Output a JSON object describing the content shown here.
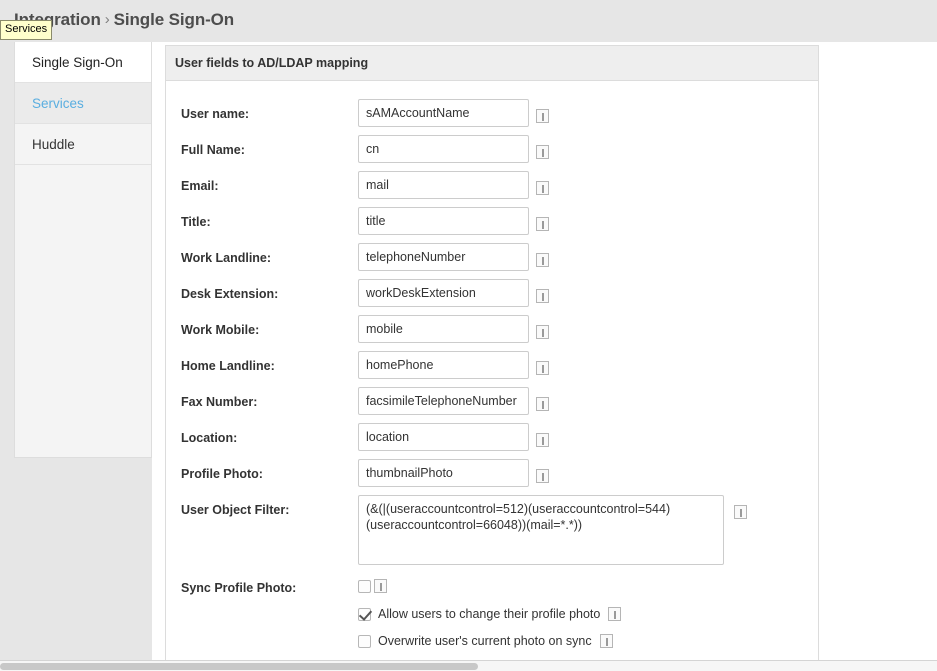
{
  "header": {
    "breadcrumb_parent": "Integration",
    "breadcrumb_separator": "›",
    "breadcrumb_current": "Single Sign-On"
  },
  "tooltip": {
    "text": "Services"
  },
  "sidebar": {
    "items": [
      {
        "label": "Single Sign-On",
        "state": "active"
      },
      {
        "label": "Services",
        "state": "hovered"
      },
      {
        "label": "Huddle",
        "state": "normal"
      }
    ]
  },
  "panel": {
    "title": "User fields to AD/LDAP mapping",
    "info_icon_name": "info-icon",
    "fields": [
      {
        "label": "User name:",
        "value": "sAMAccountName"
      },
      {
        "label": "Full Name:",
        "value": "cn"
      },
      {
        "label": "Email:",
        "value": "mail"
      },
      {
        "label": "Title:",
        "value": "title"
      },
      {
        "label": "Work Landline:",
        "value": "telephoneNumber"
      },
      {
        "label": "Desk Extension:",
        "value": "workDeskExtension"
      },
      {
        "label": "Work Mobile:",
        "value": "mobile"
      },
      {
        "label": "Home Landline:",
        "value": "homePhone"
      },
      {
        "label": "Fax Number:",
        "value": "facsimileTelephoneNumber"
      },
      {
        "label": "Location:",
        "value": "location"
      },
      {
        "label": "Profile Photo:",
        "value": "thumbnailPhoto"
      }
    ],
    "filter": {
      "label": "User Object Filter:",
      "value": "(&(|(useraccountcontrol=512)(useraccountcontrol=544)\n(useraccountcontrol=66048))(mail=*.*))"
    },
    "sync_photo": {
      "label": "Sync Profile Photo:",
      "checked": false
    },
    "options": [
      {
        "label": "Allow users to change their profile photo",
        "checked": true
      },
      {
        "label": "Overwrite user's current photo on sync",
        "checked": false
      }
    ]
  },
  "colors": {
    "page_background": "#ffffff",
    "header_band": "#e6e6e6",
    "panel_header": "#eeeeee",
    "accent_link": "#5aaee0",
    "tooltip_background": "#ffffcc",
    "text_primary": "#333333",
    "border": "#dcdcdc"
  }
}
